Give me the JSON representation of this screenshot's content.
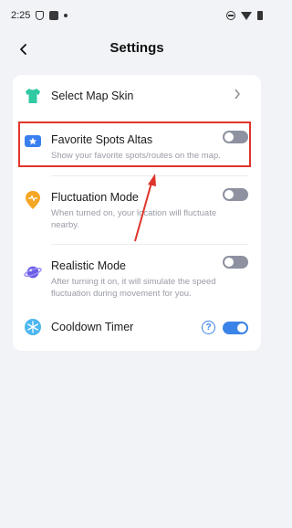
{
  "status_bar": {
    "time": "2:25"
  },
  "header": {
    "title": "Settings",
    "back_icon": "chevron-left-icon"
  },
  "settings": {
    "map_skin": {
      "title": "Select Map Skin",
      "icon": "shirt-icon",
      "icon_color": "#2fc9a2"
    },
    "favorite_spots": {
      "title": "Favorite Spots Altas",
      "description": "Show your favorite spots/routes on the map.",
      "icon": "star-ticket-icon",
      "icon_color": "#3a7ff0",
      "enabled": false
    },
    "fluctuation_mode": {
      "title": "Fluctuation Mode",
      "description": "When turned on, your location will fluctuate nearby.",
      "icon": "location-pulse-icon",
      "icon_color": "#f5a623",
      "enabled": false
    },
    "realistic_mode": {
      "title": "Realistic Mode",
      "description": "After turning it on, it will simulate the speed fluctuation during movement for you.",
      "icon": "planet-icon",
      "icon_color": "#6b5ce7",
      "enabled": false
    },
    "cooldown_timer": {
      "title": "Cooldown Timer",
      "icon": "snowflake-icon",
      "icon_color": "#4cb7f0",
      "help_label": "?",
      "enabled": true
    }
  },
  "colors": {
    "toggle_off": "#8d91a0",
    "toggle_on": "#3a84e8",
    "annotation": "#e0352b"
  }
}
